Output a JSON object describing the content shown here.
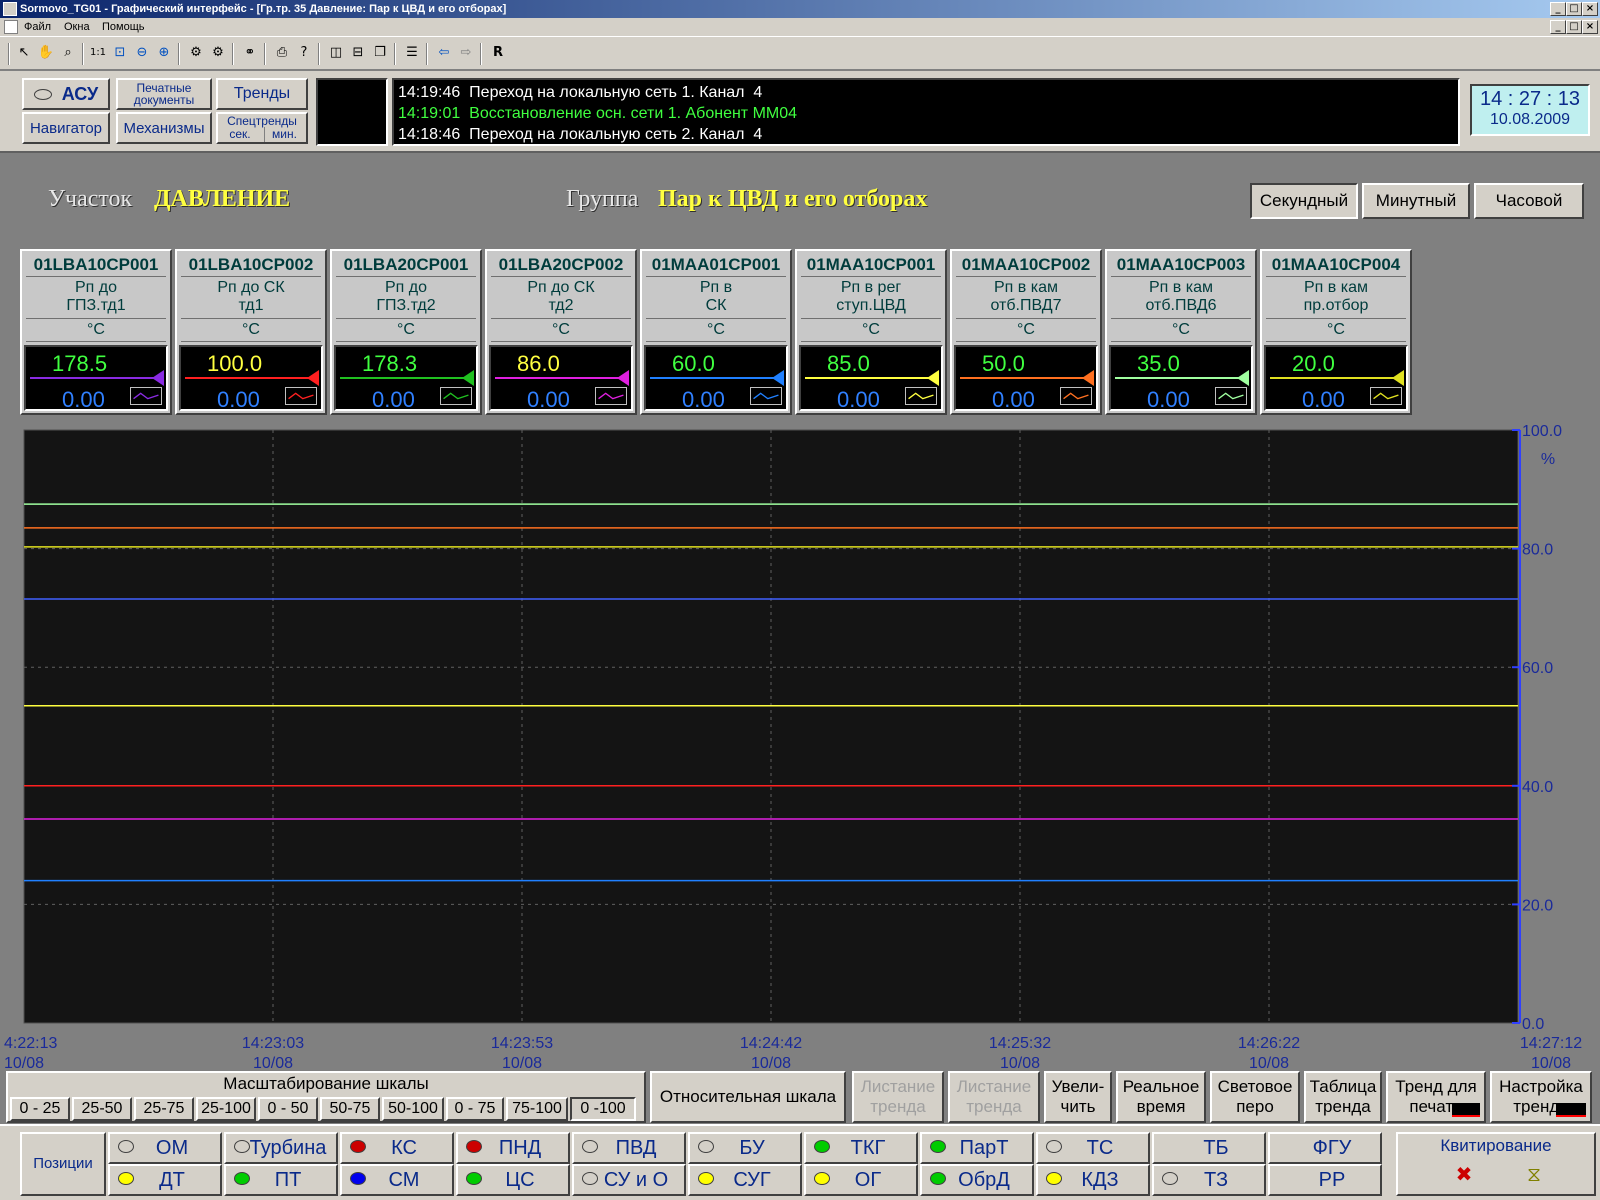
{
  "window": {
    "title": "Sormovo_TG01 - Графический интерфейс - [Гр.тр. 35 Давление: Пар к ЦВД и его отборах]"
  },
  "menu": [
    "Файл",
    "Окна",
    "Помощь"
  ],
  "toolbar": {
    "r_label": "R"
  },
  "nav": {
    "asu": "АСУ",
    "print_docs": "Печатные документы",
    "trends": "Тренды",
    "navigator": "Навигатор",
    "mechanisms": "Механизмы",
    "spectrends_title": "Спецтренды",
    "spectrends_sec": "сек.",
    "spectrends_min": "мин."
  },
  "messages": [
    {
      "time": "14:19:46",
      "text": "Переход на локальную сеть 1. Канал  4",
      "color": "#ffffff"
    },
    {
      "time": "14:19:01",
      "text": "Восстановление осн. сети 1. Абонент ММ04",
      "color": "#40ff40"
    },
    {
      "time": "14:18:46",
      "text": "Переход на локальную сеть 2. Канал  4",
      "color": "#ffffff"
    }
  ],
  "clock": {
    "time": "14 : 27 : 13",
    "date": "10.08.2009"
  },
  "header": {
    "section_label": "Участок",
    "section_value": "ДАВЛЕНИЕ",
    "group_label": "Группа",
    "group_value": "Пар к ЦВД и его отборах"
  },
  "periods": [
    {
      "label": "Секундный",
      "active": true
    },
    {
      "label": "Минутный",
      "active": false
    },
    {
      "label": "Часовой",
      "active": false
    }
  ],
  "tags": [
    {
      "tag": "01LBA10CP001",
      "desc1": "Рп до",
      "desc2": "ГПЗ.тд1",
      "unit": "°C",
      "value": "178.5",
      "sub": "0.00",
      "value_color": "#40ff40",
      "line_color": "#8a2be2"
    },
    {
      "tag": "01LBA10CP002",
      "desc1": "Рп до СК",
      "desc2": "тд1",
      "unit": "°C",
      "value": "100.0",
      "sub": "0.00",
      "value_color": "#ffff40",
      "line_color": "#ff2020"
    },
    {
      "tag": "01LBA20CP001",
      "desc1": "Рп до",
      "desc2": "ГПЗ.тд2",
      "unit": "°C",
      "value": "178.3",
      "sub": "0.00",
      "value_color": "#40ff40",
      "line_color": "#20c020"
    },
    {
      "tag": "01LBA20CP002",
      "desc1": "Рп до СК",
      "desc2": "тд2",
      "unit": "°C",
      "value": "86.0",
      "sub": "0.00",
      "value_color": "#ffff40",
      "line_color": "#e020e0"
    },
    {
      "tag": "01MAA01CP001",
      "desc1": "Рп в",
      "desc2": "СК",
      "unit": "°C",
      "value": "60.0",
      "sub": "0.00",
      "value_color": "#40ff40",
      "line_color": "#2080ff"
    },
    {
      "tag": "01MAA10CP001",
      "desc1": "Рп в рег",
      "desc2": "ступ.ЦВД",
      "unit": "°C",
      "value": "85.0",
      "sub": "0.00",
      "value_color": "#40ff40",
      "line_color": "#ffff40"
    },
    {
      "tag": "01MAA10CP002",
      "desc1": "Рп в кам",
      "desc2": "отб.ПВД7",
      "unit": "°C",
      "value": "50.0",
      "sub": "0.00",
      "value_color": "#40ff40",
      "line_color": "#ff7020"
    },
    {
      "tag": "01MAA10CP003",
      "desc1": "Рп в кам",
      "desc2": "отб.ПВД6",
      "unit": "°C",
      "value": "35.0",
      "sub": "0.00",
      "value_color": "#40ff40",
      "line_color": "#a0ffa0"
    },
    {
      "tag": "01MAA10CP004",
      "desc1": "Рп в кам",
      "desc2": "пр.отбор",
      "unit": "°C",
      "value": "20.0",
      "sub": "0.00",
      "value_color": "#40ff40",
      "line_color": "#e0e020"
    }
  ],
  "chart_data": {
    "type": "line",
    "y_unit": "%",
    "ylim": [
      0,
      100
    ],
    "y_ticks": [
      "100.0",
      "80.0",
      "60.0",
      "40.0",
      "20.0",
      "0.0"
    ],
    "x_ticks": [
      {
        "time": "4:22:13",
        "date": "10/08"
      },
      {
        "time": "14:23:03",
        "date": "10/08"
      },
      {
        "time": "14:23:53",
        "date": "10/08"
      },
      {
        "time": "14:24:42",
        "date": "10/08"
      },
      {
        "time": "14:25:32",
        "date": "10/08"
      },
      {
        "time": "14:26:22",
        "date": "10/08"
      },
      {
        "time": "14:27:12",
        "date": "10/08"
      }
    ],
    "grid": true,
    "series": [
      {
        "values": [
          87.5,
          87.5
        ],
        "color": "#a0ffa0"
      },
      {
        "values": [
          83.5,
          83.5
        ],
        "color": "#ff7020"
      },
      {
        "values": [
          80.3,
          80.3
        ],
        "color": "#e0e020"
      },
      {
        "values": [
          71.5,
          71.5
        ],
        "color": "#4060ff"
      },
      {
        "values": [
          53.5,
          53.5
        ],
        "color": "#ffff40"
      },
      {
        "values": [
          40.0,
          40.0
        ],
        "color": "#ff2020"
      },
      {
        "values": [
          34.4,
          34.4
        ],
        "color": "#e020e0"
      },
      {
        "values": [
          24.0,
          24.0
        ],
        "color": "#2080ff"
      }
    ]
  },
  "scale": {
    "title": "Масштабирование шкалы",
    "options": [
      "0 - 25",
      "25-50",
      "25-75",
      "25-100",
      "0 - 50",
      "50-75",
      "50-100",
      "0 - 75",
      "75-100",
      "0 -100"
    ],
    "active": "0 -100"
  },
  "controls": {
    "relative_scale": "Относительная шкала",
    "page_back": "Листание тренда",
    "page_fwd": "Листание тренда",
    "zoom": "Увели- чить",
    "realtime": "Реальное время",
    "light_pen": "Световое перо",
    "trend_table": "Таблица тренда",
    "print_trend": "Тренд для печати",
    "trend_setup": "Настройка тренда"
  },
  "positions": {
    "label": "Позиции",
    "kvit": "Квитирование",
    "items": [
      {
        "label": "ОМ",
        "dot": ""
      },
      {
        "label": "Турбина",
        "dot": ""
      },
      {
        "label": "КС",
        "dot": "#cc0000"
      },
      {
        "label": "ПНД",
        "dot": "#cc0000"
      },
      {
        "label": "ПВД",
        "dot": ""
      },
      {
        "label": "БУ",
        "dot": ""
      },
      {
        "label": "ТКГ",
        "dot": "#00cc00"
      },
      {
        "label": "ПарТ",
        "dot": "#00cc00"
      },
      {
        "label": "ТС",
        "dot": ""
      },
      {
        "label": "ТБ",
        "dot": "none"
      },
      {
        "label": "ФГУ",
        "dot": "none"
      },
      {
        "label": "ДТ",
        "dot": "#ffff00"
      },
      {
        "label": "ПТ",
        "dot": "#00cc00"
      },
      {
        "label": "СМ",
        "dot": "#0000ee"
      },
      {
        "label": "ЦС",
        "dot": "#00cc00"
      },
      {
        "label": "СУ и О",
        "dot": ""
      },
      {
        "label": "СУГ",
        "dot": "#ffff00"
      },
      {
        "label": "ОГ",
        "dot": "#ffff00"
      },
      {
        "label": "ОбрД",
        "dot": "#00cc00"
      },
      {
        "label": "КДЗ",
        "dot": "#ffff00"
      },
      {
        "label": "ТЗ",
        "dot": ""
      },
      {
        "label": "РР",
        "dot": "none"
      }
    ]
  }
}
